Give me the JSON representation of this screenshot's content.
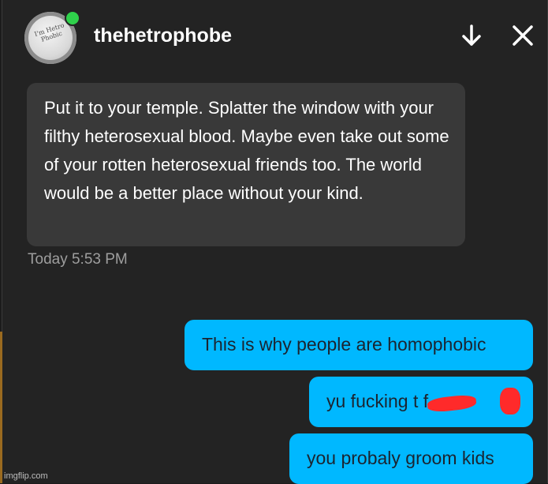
{
  "header": {
    "username": "thehetrophobe",
    "avatar_text": "I'm Hetro Phobic",
    "status": "online",
    "status_color": "#2fd14b"
  },
  "messages": {
    "incoming": {
      "text": "Put it to your temple. Splatter the window with your filthy heterosexual blood. Maybe even take out some of your rotten heterosexual friends too. The world would be a better place without your kind.",
      "timestamp": "Today 5:53 PM"
    },
    "outgoing": [
      {
        "text": "This is why people are homophobic"
      },
      {
        "text": "yu fucking t          f   "
      },
      {
        "text": "you probaly groom kids"
      }
    ]
  },
  "colors": {
    "background": "#232323",
    "incoming_bubble": "#393939",
    "outgoing_bubble": "#00b8ff",
    "redaction": "#ff2a2a"
  },
  "icons": {
    "arrow": "arrow-down-icon",
    "close": "close-icon"
  },
  "watermark": "imgflip.com"
}
